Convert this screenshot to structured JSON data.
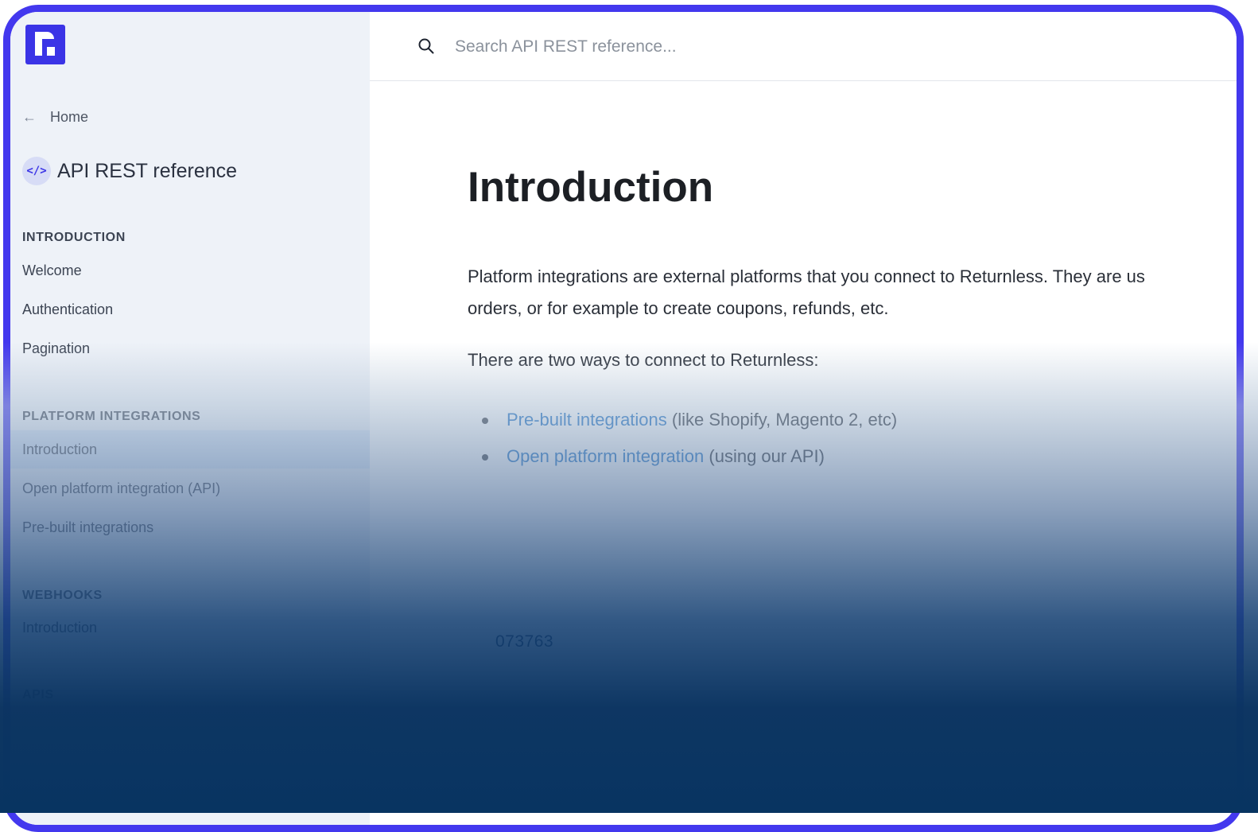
{
  "brand": {
    "logo_letter": "r",
    "accent": "#4338ee"
  },
  "sidebar": {
    "home_label": "Home",
    "api_title": "API REST reference",
    "api_icon_text": "</>",
    "sections": [
      {
        "title": "INTRODUCTION",
        "items": [
          "Welcome",
          "Authentication",
          "Pagination"
        ]
      },
      {
        "title": "PLATFORM INTEGRATIONS",
        "items": [
          "Introduction",
          "Open platform integration (API)",
          "Pre-built integrations"
        ]
      },
      {
        "title": "WEBHOOKS",
        "items": [
          "Introduction"
        ]
      },
      {
        "title": "APIS",
        "items": []
      }
    ],
    "active_item": "Introduction"
  },
  "search": {
    "placeholder": "Search API REST reference..."
  },
  "content": {
    "title": "Introduction",
    "paragraph1_line1": "Platform integrations are external platforms that you connect to Returnless. They are us",
    "paragraph1_line2": "orders, or for example to create coupons, refunds, etc.",
    "paragraph2": "There are two ways to connect to Returnless:",
    "bullets": [
      {
        "link": "Pre-built integrations",
        "rest": " (like Shopify, Magento 2, etc)"
      },
      {
        "link": "Open platform integration",
        "rest": " (using our API)"
      }
    ],
    "code": "073763"
  }
}
